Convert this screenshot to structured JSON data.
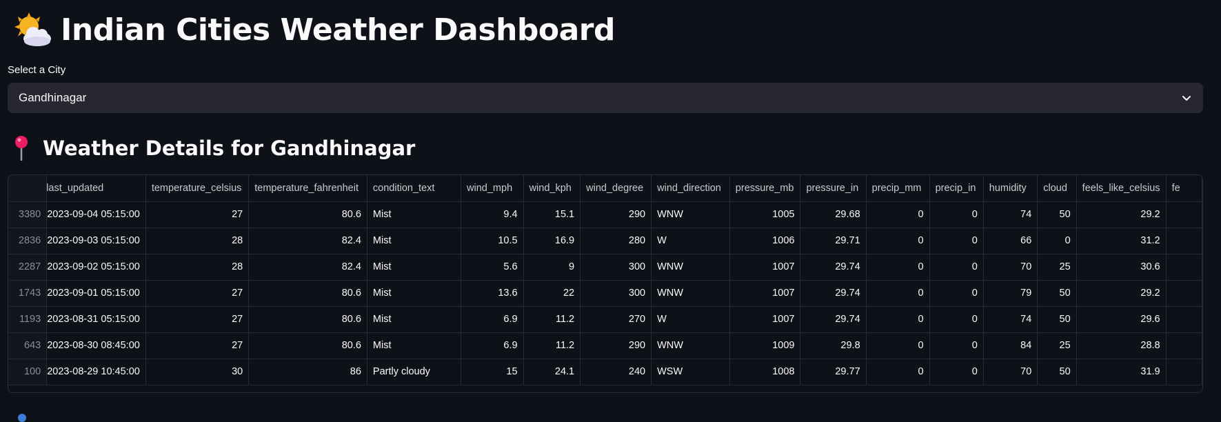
{
  "header": {
    "title": "Indian Cities Weather Dashboard",
    "icon": "sun-behind-cloud-icon"
  },
  "city_select": {
    "label": "Select a City",
    "value": "Gandhinagar"
  },
  "details": {
    "subtitle": "Weather Details for Gandhinagar",
    "icon": "round-pushpin-icon"
  },
  "table": {
    "columns": [
      "",
      "last_updated",
      "temperature_celsius",
      "temperature_fahrenheit",
      "condition_text",
      "wind_mph",
      "wind_kph",
      "wind_degree",
      "wind_direction",
      "pressure_mb",
      "pressure_in",
      "precip_mm",
      "precip_in",
      "humidity",
      "cloud",
      "feels_like_celsius",
      "fe"
    ],
    "rows": [
      [
        "3380",
        "2023-09-04 05:15:00",
        "27",
        "80.6",
        "Mist",
        "9.4",
        "15.1",
        "290",
        "WNW",
        "1005",
        "29.68",
        "0",
        "0",
        "74",
        "50",
        "29.2"
      ],
      [
        "2836",
        "2023-09-03 05:15:00",
        "28",
        "82.4",
        "Mist",
        "10.5",
        "16.9",
        "280",
        "W",
        "1006",
        "29.71",
        "0",
        "0",
        "66",
        "0",
        "31.2"
      ],
      [
        "2287",
        "2023-09-02 05:15:00",
        "28",
        "82.4",
        "Mist",
        "5.6",
        "9",
        "300",
        "WNW",
        "1007",
        "29.74",
        "0",
        "0",
        "70",
        "25",
        "30.6"
      ],
      [
        "1743",
        "2023-09-01 05:15:00",
        "27",
        "80.6",
        "Mist",
        "13.6",
        "22",
        "300",
        "WNW",
        "1007",
        "29.74",
        "0",
        "0",
        "79",
        "50",
        "29.2"
      ],
      [
        "1193",
        "2023-08-31 05:15:00",
        "27",
        "80.6",
        "Mist",
        "6.9",
        "11.2",
        "270",
        "W",
        "1007",
        "29.74",
        "0",
        "0",
        "74",
        "50",
        "29.6"
      ],
      [
        "643",
        "2023-08-30 08:45:00",
        "27",
        "80.6",
        "Mist",
        "6.9",
        "11.2",
        "290",
        "WNW",
        "1009",
        "29.8",
        "0",
        "0",
        "84",
        "25",
        "28.8"
      ],
      [
        "100",
        "2023-08-29 10:45:00",
        "30",
        "86",
        "Partly cloudy",
        "15",
        "24.1",
        "240",
        "WSW",
        "1008",
        "29.77",
        "0",
        "0",
        "70",
        "50",
        "31.9"
      ]
    ]
  },
  "colors": {
    "background": "#0e1117",
    "input_bg": "#262730",
    "border": "#262a33",
    "text": "#fafafa"
  }
}
